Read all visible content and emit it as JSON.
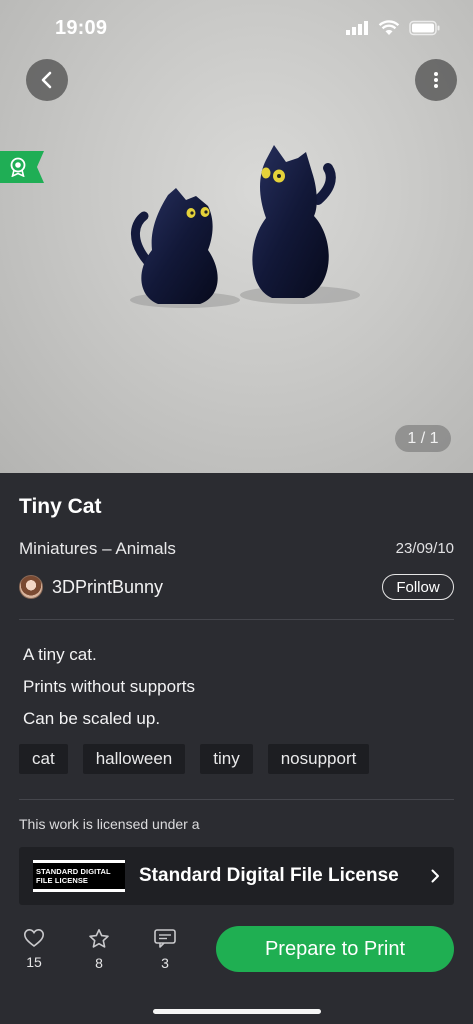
{
  "status_bar": {
    "time": "19:09"
  },
  "gallery": {
    "indicator": "1 / 1"
  },
  "model": {
    "title": "Tiny Cat",
    "category": "Miniatures – Animals",
    "date": "23/09/10",
    "author": "3DPrintBunny",
    "follow_label": "Follow",
    "description": [
      "A tiny cat.",
      "Prints without supports",
      "Can be scaled up."
    ],
    "tags": [
      "cat",
      "halloween",
      "tiny",
      "nosupport"
    ]
  },
  "license": {
    "note": "This work is licensed under a",
    "logo_line1": "STANDARD DIGITAL",
    "logo_line2": "FILE LICENSE",
    "name": "Standard Digital File License"
  },
  "stats": {
    "likes": "15",
    "collects": "8",
    "comments": "3"
  },
  "actions": {
    "print_label": "Prepare to Print"
  },
  "icons": {
    "back": "chevron-left-icon",
    "more": "more-vertical-icon",
    "award": "award-ribbon-icon",
    "like": "heart-icon",
    "collect": "star-icon",
    "comment": "comment-icon",
    "license_open": "chevron-right-icon"
  },
  "colors": {
    "accent": "#1faf52",
    "background": "#2b2c31",
    "card": "#1f2024",
    "tag": "#1d1e22"
  }
}
